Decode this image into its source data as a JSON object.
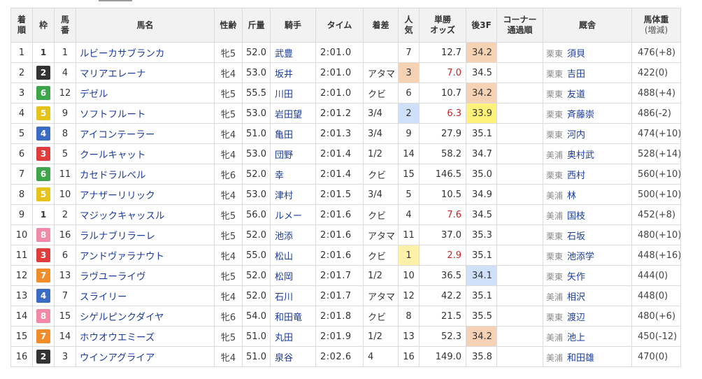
{
  "headers": {
    "finish": [
      "着",
      "順"
    ],
    "frame": "枠",
    "horse_no": [
      "馬",
      "番"
    ],
    "horse_name": "馬名",
    "sex_age": "性齢",
    "weight_carried": "斤量",
    "jockey": "騎手",
    "time": "タイム",
    "margin": "着差",
    "popularity": [
      "人",
      "気"
    ],
    "odds": [
      "単勝",
      "オッズ"
    ],
    "last3f": "後3F",
    "corner": [
      "コーナー",
      "通過順"
    ],
    "stable": "厩舎",
    "body_weight": [
      "馬体重",
      "(増減)"
    ]
  },
  "rows": [
    {
      "finish": "1",
      "frame": "1",
      "horse_no": "1",
      "name": "ルビーカサブランカ",
      "sex_age": "牝5",
      "kg": "52.0",
      "jockey": "武豊",
      "time": "2:01.0",
      "margin": "",
      "pop": "7",
      "odds": "12.7",
      "odds_red": false,
      "last3f": "34.2",
      "l3_rank": 3,
      "pop_rank": 0,
      "region": "栗東",
      "trainer": "須貝",
      "weight": "476(+8)"
    },
    {
      "finish": "2",
      "frame": "2",
      "horse_no": "4",
      "name": "マリアエレーナ",
      "sex_age": "牝4",
      "kg": "53.0",
      "jockey": "坂井",
      "time": "2:01.0",
      "margin": "アタマ",
      "pop": "3",
      "odds": "7.0",
      "odds_red": true,
      "last3f": "34.5",
      "l3_rank": 0,
      "pop_rank": 3,
      "region": "栗東",
      "trainer": "吉田",
      "weight": "422(0)"
    },
    {
      "finish": "3",
      "frame": "6",
      "horse_no": "12",
      "name": "デゼル",
      "sex_age": "牝5",
      "kg": "55.5",
      "jockey": "川田",
      "time": "2:01.0",
      "margin": "クビ",
      "pop": "6",
      "odds": "10.7",
      "odds_red": false,
      "last3f": "34.2",
      "l3_rank": 3,
      "pop_rank": 0,
      "region": "栗東",
      "trainer": "友道",
      "weight": "488(+4)"
    },
    {
      "finish": "4",
      "frame": "5",
      "horse_no": "9",
      "name": "ソフトフルート",
      "sex_age": "牝5",
      "kg": "53.0",
      "jockey": "岩田望",
      "time": "2:01.2",
      "margin": "3/4",
      "pop": "2",
      "odds": "6.3",
      "odds_red": true,
      "last3f": "33.9",
      "l3_rank": 1,
      "pop_rank": 2,
      "region": "栗東",
      "trainer": "斉藤崇",
      "weight": "486(-2)"
    },
    {
      "finish": "5",
      "frame": "4",
      "horse_no": "8",
      "name": "アイコンテーラー",
      "sex_age": "牝4",
      "kg": "51.0",
      "jockey": "亀田",
      "time": "2:01.3",
      "margin": "3/4",
      "pop": "9",
      "odds": "27.9",
      "odds_red": false,
      "last3f": "35.1",
      "l3_rank": 0,
      "pop_rank": 0,
      "region": "栗東",
      "trainer": "河内",
      "weight": "474(+10)"
    },
    {
      "finish": "6",
      "frame": "3",
      "horse_no": "5",
      "name": "クールキャット",
      "sex_age": "牝4",
      "kg": "53.0",
      "jockey": "団野",
      "time": "2:01.4",
      "margin": "1/2",
      "pop": "14",
      "odds": "58.2",
      "odds_red": false,
      "last3f": "34.7",
      "l3_rank": 0,
      "pop_rank": 0,
      "region": "美浦",
      "trainer": "奥村武",
      "weight": "528(+14)"
    },
    {
      "finish": "7",
      "frame": "6",
      "horse_no": "11",
      "name": "カセドラルベル",
      "sex_age": "牝6",
      "kg": "52.0",
      "jockey": "幸",
      "time": "2:01.4",
      "margin": "クビ",
      "pop": "15",
      "odds": "146.5",
      "odds_red": false,
      "last3f": "35.0",
      "l3_rank": 0,
      "pop_rank": 0,
      "region": "栗東",
      "trainer": "西村",
      "weight": "560(+10)"
    },
    {
      "finish": "8",
      "frame": "5",
      "horse_no": "10",
      "name": "アナザーリリック",
      "sex_age": "牝4",
      "kg": "53.0",
      "jockey": "津村",
      "time": "2:01.5",
      "margin": "3/4",
      "pop": "5",
      "odds": "10.5",
      "odds_red": false,
      "last3f": "34.9",
      "l3_rank": 0,
      "pop_rank": 0,
      "region": "美浦",
      "trainer": "林",
      "weight": "500(+10)"
    },
    {
      "finish": "9",
      "frame": "1",
      "horse_no": "2",
      "name": "マジックキャッスル",
      "sex_age": "牝5",
      "kg": "56.0",
      "jockey": "ルメー",
      "time": "2:01.6",
      "margin": "クビ",
      "pop": "4",
      "odds": "7.6",
      "odds_red": true,
      "last3f": "34.5",
      "l3_rank": 0,
      "pop_rank": 0,
      "region": "美浦",
      "trainer": "国枝",
      "weight": "452(+8)"
    },
    {
      "finish": "10",
      "frame": "8",
      "horse_no": "16",
      "name": "ラルナブリラーレ",
      "sex_age": "牝5",
      "kg": "52.0",
      "jockey": "池添",
      "time": "2:01.6",
      "margin": "アタマ",
      "pop": "11",
      "odds": "37.0",
      "odds_red": false,
      "last3f": "35.3",
      "l3_rank": 0,
      "pop_rank": 0,
      "region": "栗東",
      "trainer": "石坂",
      "weight": "480(+10)"
    },
    {
      "finish": "11",
      "frame": "3",
      "horse_no": "6",
      "name": "アンドヴァラナウト",
      "sex_age": "牝4",
      "kg": "55.0",
      "jockey": "松山",
      "time": "2:01.6",
      "margin": "クビ",
      "pop": "1",
      "odds": "2.9",
      "odds_red": true,
      "last3f": "35.1",
      "l3_rank": 0,
      "pop_rank": 1,
      "region": "栗東",
      "trainer": "池添学",
      "weight": "448(+16)"
    },
    {
      "finish": "12",
      "frame": "7",
      "horse_no": "13",
      "name": "ラヴユーライヴ",
      "sex_age": "牝5",
      "kg": "52.0",
      "jockey": "松岡",
      "time": "2:01.7",
      "margin": "1/2",
      "pop": "10",
      "odds": "36.5",
      "odds_red": false,
      "last3f": "34.1",
      "l3_rank": 2,
      "pop_rank": 0,
      "region": "栗東",
      "trainer": "矢作",
      "weight": "444(0)"
    },
    {
      "finish": "13",
      "frame": "4",
      "horse_no": "7",
      "name": "スライリー",
      "sex_age": "牝4",
      "kg": "52.0",
      "jockey": "石川",
      "time": "2:01.7",
      "margin": "アタマ",
      "pop": "12",
      "odds": "42.2",
      "odds_red": false,
      "last3f": "35.1",
      "l3_rank": 0,
      "pop_rank": 0,
      "region": "美浦",
      "trainer": "相沢",
      "weight": "448(0)"
    },
    {
      "finish": "14",
      "frame": "8",
      "horse_no": "15",
      "name": "シゲルピンクダイヤ",
      "sex_age": "牝6",
      "kg": "54.0",
      "jockey": "和田竜",
      "time": "2:01.8",
      "margin": "クビ",
      "pop": "8",
      "odds": "21.5",
      "odds_red": false,
      "last3f": "35.5",
      "l3_rank": 0,
      "pop_rank": 0,
      "region": "栗東",
      "trainer": "渡辺",
      "weight": "480(+6)"
    },
    {
      "finish": "15",
      "frame": "7",
      "horse_no": "14",
      "name": "ホウオウエミーズ",
      "sex_age": "牝5",
      "kg": "51.0",
      "jockey": "丸田",
      "time": "2:01.9",
      "margin": "1/2",
      "pop": "13",
      "odds": "52.3",
      "odds_red": false,
      "last3f": "34.2",
      "l3_rank": 3,
      "pop_rank": 0,
      "region": "美浦",
      "trainer": "池上",
      "weight": "450(-12)"
    },
    {
      "finish": "16",
      "frame": "2",
      "horse_no": "3",
      "name": "ウインアグライア",
      "sex_age": "牝4",
      "kg": "51.0",
      "jockey": "泉谷",
      "time": "2:02.6",
      "margin": "4",
      "pop": "16",
      "odds": "149.0",
      "odds_red": false,
      "last3f": "35.8",
      "l3_rank": 0,
      "pop_rank": 0,
      "region": "美浦",
      "trainer": "和田雄",
      "weight": "470(0)"
    }
  ]
}
